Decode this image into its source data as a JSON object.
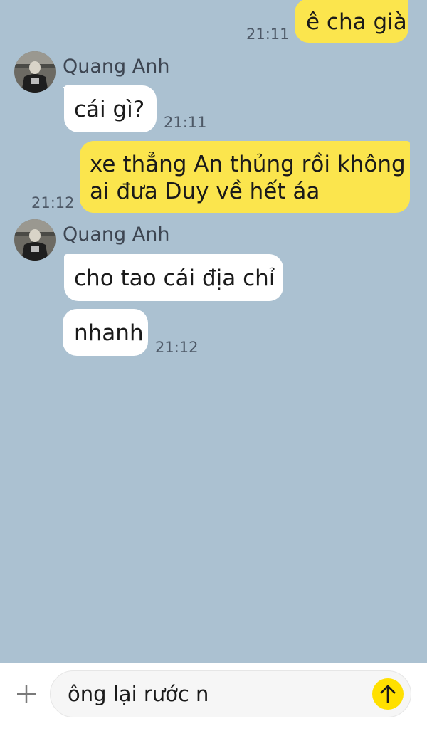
{
  "colors": {
    "background": "#abc1d1",
    "my_bubble": "#fbe54d",
    "their_bubble": "#ffffff",
    "send_button": "#ffe000"
  },
  "messages": [
    {
      "from": "me",
      "text": "ê cha già",
      "time": "21:11"
    },
    {
      "from": "them",
      "sender": "Quang Anh",
      "text": "cái gì?",
      "time": "21:11"
    },
    {
      "from": "me",
      "lines": [
        "xe thẳng An thủng rồi không",
        "ai đưa Duy về hết áa"
      ],
      "time": "21:12"
    },
    {
      "from": "them",
      "sender": "Quang Anh",
      "text": "cho tao cái địa chỉ"
    },
    {
      "from": "them",
      "text": "nhanh",
      "time": "21:12"
    }
  ],
  "composer": {
    "draft": "ông lại rước n",
    "plus_icon": "plus-icon",
    "send_icon": "arrow-up-icon"
  }
}
